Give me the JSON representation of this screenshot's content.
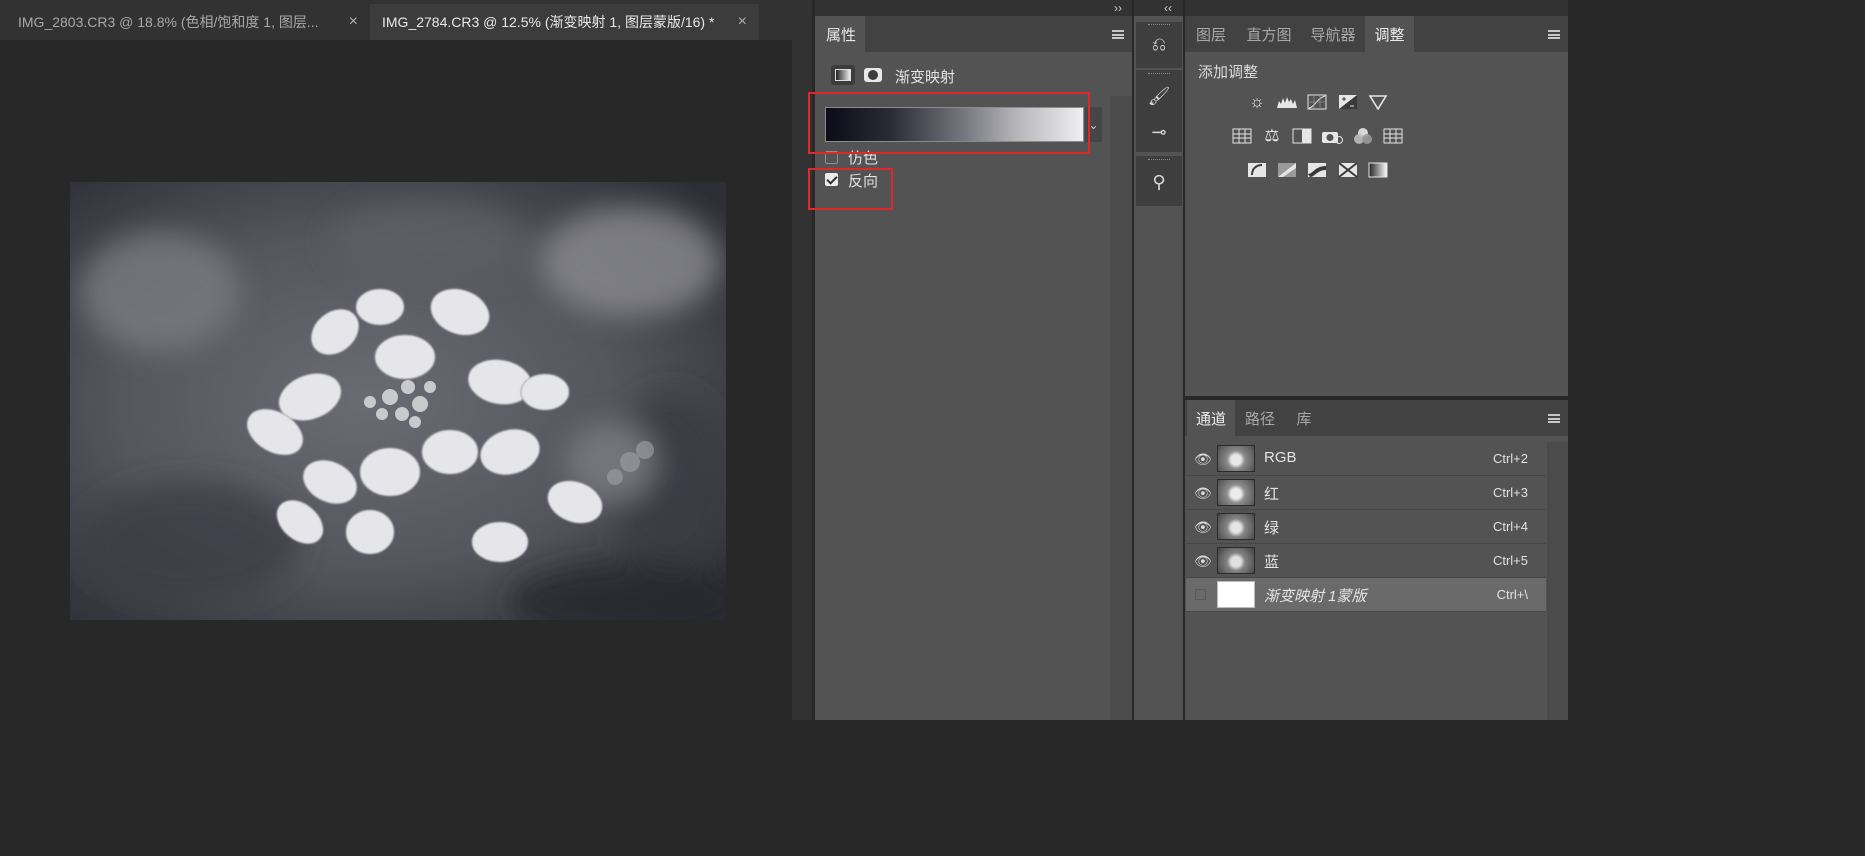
{
  "document_tabs": [
    {
      "title": "IMG_2803.CR3 @ 18.8% (色相/饱和度 1, 图层...",
      "close": "×",
      "active": false
    },
    {
      "title": "IMG_2784.CR3 @ 12.5% (渐变映射 1, 图层蒙版/16) *",
      "close": "×",
      "active": true
    }
  ],
  "properties_panel": {
    "tab": "属性",
    "adjustment_title": "渐变映射",
    "options": [
      {
        "label": "仿色",
        "checked": false
      },
      {
        "label": "反向",
        "checked": true
      }
    ],
    "gradient_dropdown_glyph": "⌄"
  },
  "collapse_glyphs": {
    "left": "››",
    "right": "‹‹"
  },
  "right_top_panel": {
    "tabs": [
      "图层",
      "直方图",
      "导航器",
      "调整"
    ],
    "active_tab": "调整",
    "heading": "添加调整",
    "icon_rows": [
      [
        "brightness-contrast-icon",
        "levels-icon",
        "curves-icon",
        "exposure-icon",
        "vibrance-icon"
      ],
      [
        "hue-saturation-icon",
        "color-balance-icon",
        "black-white-icon",
        "photo-filter-icon",
        "channel-mixer-icon",
        "color-lookup-icon"
      ],
      [
        "invert-icon",
        "posterize-icon",
        "threshold-icon",
        "selective-color-icon",
        "gradient-map-icon"
      ]
    ]
  },
  "channels_panel": {
    "tabs": [
      "通道",
      "路径",
      "库"
    ],
    "active_tab": "通道",
    "rows": [
      {
        "name": "RGB",
        "shortcut": "Ctrl+2",
        "visible": true,
        "selected": false,
        "thumb": "flower"
      },
      {
        "name": "红",
        "shortcut": "Ctrl+3",
        "visible": true,
        "selected": false,
        "thumb": "flower"
      },
      {
        "name": "绿",
        "shortcut": "Ctrl+4",
        "visible": true,
        "selected": false,
        "thumb": "flower"
      },
      {
        "name": "蓝",
        "shortcut": "Ctrl+5",
        "visible": true,
        "selected": false,
        "thumb": "flower"
      },
      {
        "name": "渐变映射 1蒙版",
        "shortcut": "Ctrl+\\",
        "visible": false,
        "selected": true,
        "thumb": "white"
      }
    ]
  },
  "colors": {
    "highlight": "#e0282a",
    "panel": "#535353",
    "canvas": "#282828"
  }
}
